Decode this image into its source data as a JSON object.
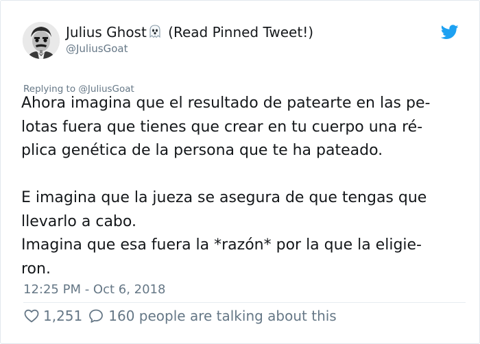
{
  "author": {
    "display_name": "Julius Ghost",
    "name_suffix": "(Read Pinned Tweet!)",
    "handle": "@JuliusGoat",
    "avatar": "avatar-photo",
    "name_emoji": "ghost-emoji"
  },
  "brand": {
    "icon": "twitter-bird-icon",
    "color": "#1da1f2"
  },
  "replying_to": "Replying to @JuliusGoat",
  "text": {
    "paragraph1": [
      "Ahora imagina que el resultado de patearte en las pe-",
      "lotas fuera que tienes que crear en tu cuerpo una ré-",
      "plica genética de la persona que te ha pateado."
    ],
    "paragraph2": [
      "E imagina que la jueza se asegura de que tengas que",
      "llevarlo a cabo.",
      "Imagina que esa fuera la *razón* por la que la eligie-",
      "ron."
    ]
  },
  "timestamp": "12:25 PM - Oct 6, 2018",
  "stats": {
    "likes_icon": "heart-icon",
    "likes": "1,251",
    "replies_icon": "reply-bubble-icon",
    "talking": "160 people are talking about this"
  },
  "colors": {
    "text": "#14171a",
    "secondary": "#657786",
    "border": "#e1e8ed"
  }
}
